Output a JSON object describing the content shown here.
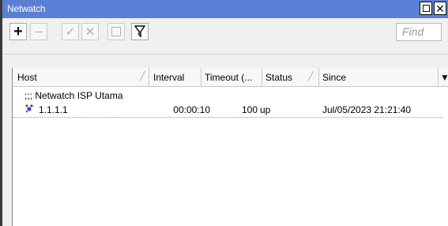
{
  "window": {
    "title": "Netwatch"
  },
  "toolbar": {
    "add_label": "+",
    "remove_label": "−",
    "enable_label": "✓",
    "disable_label": "✕",
    "comment_label": "",
    "filter_label": "",
    "find_placeholder": "Find"
  },
  "table": {
    "columns": [
      "Host",
      "Interval",
      "Timeout (...",
      "Status",
      "Since"
    ],
    "comment_row": ";;; Netwatch ISP Utama",
    "rows": [
      {
        "host": "1.1.1.1",
        "interval": "00:00:10",
        "timeout": "100",
        "status": "up",
        "since": "Jul/05/2023 21:21:40"
      }
    ]
  }
}
